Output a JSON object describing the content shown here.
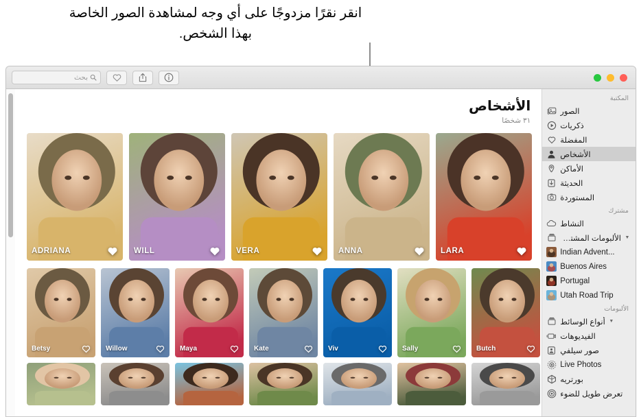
{
  "callout": {
    "text": "انقر نقرًا مزدوجًا على أي وجه لمشاهدة الصور الخاصة بهذا الشخص."
  },
  "toolbar": {
    "search_placeholder": "بحث",
    "search_value": "",
    "buttons": [
      {
        "name": "favorite-button",
        "icon": "heart-icon"
      },
      {
        "name": "share-button",
        "icon": "share-icon"
      },
      {
        "name": "info-button",
        "icon": "info-icon"
      }
    ],
    "window_controls": [
      {
        "name": "close-button",
        "color": "#ff5f57"
      },
      {
        "name": "minimize-button",
        "color": "#febc2e"
      },
      {
        "name": "zoom-button",
        "color": "#28c840"
      }
    ]
  },
  "header": {
    "title": "الأشخاص",
    "subtitle": "٣١ شخصًا"
  },
  "people": {
    "featured": [
      {
        "name": "ADRIANA",
        "favorite": true,
        "c1": "#d8b46a",
        "c2": "#7a6b4a",
        "c3": "#e8dcc8"
      },
      {
        "name": "WILL",
        "favorite": true,
        "c1": "#b58ec4",
        "c2": "#5d4439",
        "c3": "#9fb27a"
      },
      {
        "name": "VERA",
        "favorite": true,
        "c1": "#d9a32c",
        "c2": "#4a3426",
        "c3": "#cfc6b4"
      },
      {
        "name": "ANNA",
        "favorite": true,
        "c1": "#cbb48a",
        "c2": "#6d7a52",
        "c3": "#e6d9c3"
      },
      {
        "name": "LARA",
        "favorite": true,
        "c1": "#d8412a",
        "c2": "#4b3327",
        "c3": "#9aa98f"
      }
    ],
    "others": [
      {
        "name": "Betsy",
        "favorite": false,
        "c1": "#c8a273",
        "c2": "#6b5a42",
        "c3": "#e0c9a8"
      },
      {
        "name": "Willow",
        "favorite": false,
        "c1": "#5d7ea8",
        "c2": "#5a4433",
        "c3": "#b9c4d2"
      },
      {
        "name": "Maya",
        "favorite": false,
        "c1": "#c22b49",
        "c2": "#6d4a38",
        "c3": "#e8c9b2"
      },
      {
        "name": "Kate",
        "favorite": false,
        "c1": "#6f86a3",
        "c2": "#5d4a38",
        "c3": "#c3cbb8"
      },
      {
        "name": "Viv",
        "favorite": false,
        "c1": "#0a5ea8",
        "c2": "#4a3a2c",
        "c3": "#1b79c9"
      },
      {
        "name": "Sally",
        "favorite": false,
        "c1": "#7ba85c",
        "c2": "#c7a36e",
        "c3": "#e2dfc2"
      },
      {
        "name": "Butch",
        "favorite": false,
        "c1": "#c4513f",
        "c2": "#4b3a2c",
        "c3": "#6f8a4f"
      }
    ],
    "partial_row": [
      {
        "name": "",
        "c1": "#b6c08e",
        "c2": "#e2c5a5",
        "c3": "#8fa07a"
      },
      {
        "name": "",
        "c1": "#8d8d8d",
        "c2": "#5a4030",
        "c3": "#c9c2b8"
      },
      {
        "name": "",
        "c1": "#b5643f",
        "c2": "#3d2a1e",
        "c3": "#79c3e0"
      },
      {
        "name": "",
        "c1": "#6f8a4a",
        "c2": "#4a3526",
        "c3": "#dcc1a2"
      },
      {
        "name": "",
        "c1": "#9fb0c2",
        "c2": "#6a6a6a",
        "c3": "#dfe4e8"
      },
      {
        "name": "",
        "c1": "#4c5c3c",
        "c2": "#8c3a3a",
        "c3": "#e0c2a0"
      },
      {
        "name": "",
        "c1": "#9a9a9a",
        "c2": "#4a4a4a",
        "c3": "#d4d4d4"
      }
    ]
  },
  "sidebar": {
    "sections": [
      {
        "title": "المكتبة",
        "items": [
          {
            "label": "الصور",
            "icon": "photos-icon",
            "selected": false
          },
          {
            "label": "ذكريات",
            "icon": "memories-icon",
            "selected": false
          },
          {
            "label": "المفضلة",
            "icon": "heart-icon",
            "selected": false
          },
          {
            "label": "الأشخاص",
            "icon": "person-icon",
            "selected": true
          },
          {
            "label": "الأماكن",
            "icon": "pin-icon",
            "selected": false
          },
          {
            "label": "الحديثة",
            "icon": "import-icon",
            "selected": false
          },
          {
            "label": "المستوردة",
            "icon": "camera-icon",
            "selected": false
          }
        ]
      },
      {
        "title": "مشترك",
        "items": [
          {
            "label": "النشاط",
            "icon": "cloud-icon",
            "selected": false
          },
          {
            "label": "الألبومات المشتركة",
            "icon": "album-icon",
            "selected": false,
            "caret": true
          },
          {
            "label": "...Indian Advent",
            "icon": "thumb",
            "selected": false,
            "child": true,
            "t1": "#8a5a3a",
            "t2": "#3a2a1e"
          },
          {
            "label": "Buenos Aires",
            "icon": "thumb",
            "selected": false,
            "child": true,
            "t1": "#4a8ac4",
            "t2": "#c43a2a"
          },
          {
            "label": "Portugal",
            "icon": "thumb",
            "selected": false,
            "child": true,
            "t1": "#2a2018",
            "t2": "#b03a2a"
          },
          {
            "label": "Utah Road Trip",
            "icon": "thumb",
            "selected": false,
            "child": true,
            "t1": "#6ab4da",
            "t2": "#c08a5a"
          }
        ]
      },
      {
        "title": "الألبومات",
        "items": [
          {
            "label": "أنواع الوسائط",
            "icon": "album-icon",
            "selected": false,
            "caret": true
          },
          {
            "label": "الفيديوهات",
            "icon": "video-icon",
            "selected": false
          },
          {
            "label": "صور سيلفي",
            "icon": "selfie-icon",
            "selected": false
          },
          {
            "label": "Live Photos",
            "icon": "live-icon",
            "selected": false
          },
          {
            "label": "بورتريه",
            "icon": "portrait-icon",
            "selected": false
          },
          {
            "label": "تعرض طويل للضوء",
            "icon": "longexposure-icon",
            "selected": false
          }
        ]
      }
    ]
  }
}
